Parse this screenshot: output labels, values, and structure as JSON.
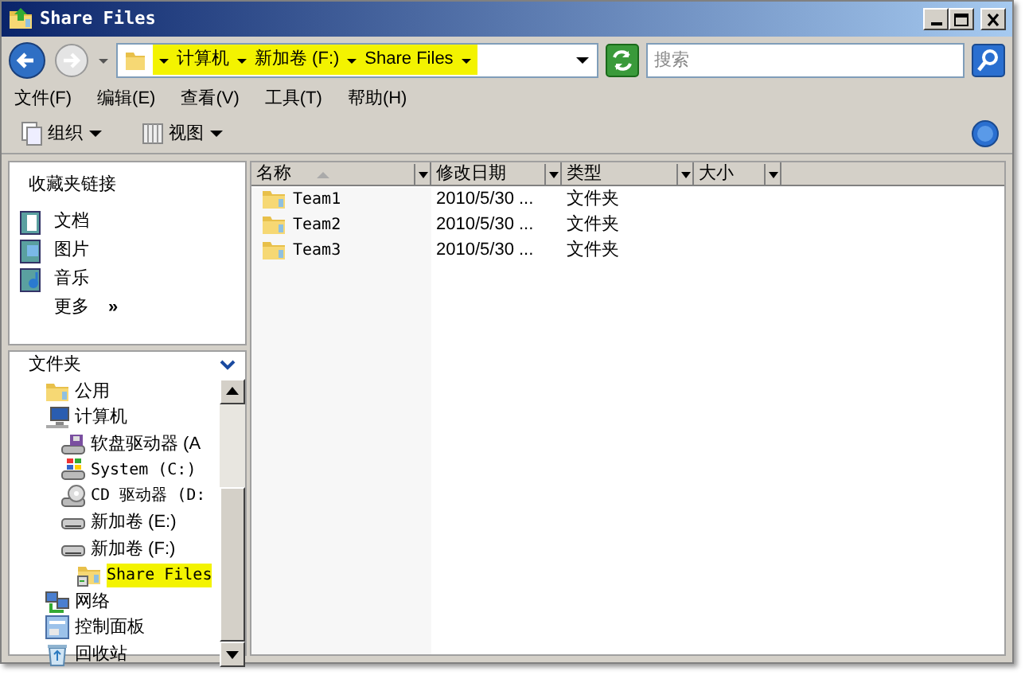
{
  "window": {
    "title": "Share Files"
  },
  "navigation": {
    "back_enabled": true,
    "forward_enabled": false
  },
  "address_bar": {
    "highlighted": true,
    "crumbs": [
      "计算机",
      "新加卷 (F:)",
      "Share Files"
    ]
  },
  "search": {
    "placeholder": "搜索"
  },
  "menu": [
    "文件(F)",
    "编辑(E)",
    "查看(V)",
    "工具(T)",
    "帮助(H)"
  ],
  "toolbar": [
    {
      "label": "组织",
      "kind": "organize"
    },
    {
      "label": "视图",
      "kind": "views"
    }
  ],
  "favorites": {
    "title": "收藏夹链接",
    "items": [
      {
        "label": "文档",
        "kind": "documents"
      },
      {
        "label": "图片",
        "kind": "pictures"
      },
      {
        "label": "音乐",
        "kind": "music"
      }
    ],
    "more": "更多",
    "more_glyph": "»"
  },
  "folders": {
    "title": "文件夹",
    "tree": [
      {
        "label": "公用",
        "kind": "folder",
        "selected": false
      },
      {
        "label": "计算机",
        "kind": "computer",
        "selected": false,
        "children": [
          {
            "label": "软盘驱动器 (A",
            "kind": "floppy",
            "selected": false
          },
          {
            "label": "System (C:)",
            "kind": "system",
            "selected": false
          },
          {
            "label": "CD 驱动器 (D:",
            "kind": "cd",
            "selected": false
          },
          {
            "label": "新加卷 (E:)",
            "kind": "drive",
            "selected": false
          },
          {
            "label": "新加卷 (F:)",
            "kind": "drive",
            "selected": false,
            "children": [
              {
                "label": "Share Files",
                "kind": "share",
                "selected": true
              }
            ]
          }
        ]
      },
      {
        "label": "网络",
        "kind": "network",
        "selected": false
      },
      {
        "label": "控制面板",
        "kind": "control",
        "selected": false
      },
      {
        "label": "回收站",
        "kind": "recycle",
        "selected": false
      }
    ]
  },
  "file_list": {
    "columns": [
      {
        "label": "名称",
        "sorted": true
      },
      {
        "label": "修改日期",
        "sorted": false
      },
      {
        "label": "类型",
        "sorted": false
      },
      {
        "label": "大小",
        "sorted": false
      }
    ],
    "rows": [
      {
        "name": "Team1",
        "modified": "2010/5/30 ...",
        "type": "文件夹"
      },
      {
        "name": "Team2",
        "modified": "2010/5/30 ...",
        "type": "文件夹"
      },
      {
        "name": "Team3",
        "modified": "2010/5/30 ...",
        "type": "文件夹"
      }
    ]
  }
}
